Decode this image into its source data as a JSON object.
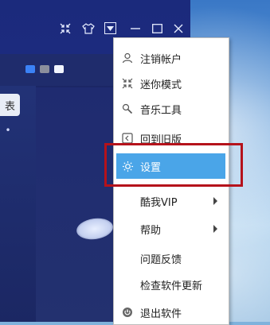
{
  "left_panel": {
    "tab_label": "表",
    "tab2_label": "•"
  },
  "menu": {
    "items": [
      {
        "label": "注销帐户",
        "icon": "user-icon"
      },
      {
        "label": "迷你模式",
        "icon": "mini-mode-icon"
      },
      {
        "label": "音乐工具",
        "icon": "tools-icon"
      },
      {
        "label": "回到旧版",
        "icon": "back-old-icon"
      },
      {
        "label": "设置",
        "icon": "gear-icon",
        "selected": true
      },
      {
        "label": "酷我VIP",
        "submenu": true
      },
      {
        "label": "帮助",
        "submenu": true
      },
      {
        "label": "问题反馈"
      },
      {
        "label": "检查软件更新"
      },
      {
        "label": "退出软件",
        "icon": "power-icon"
      }
    ]
  },
  "colors": {
    "selected": "#4aa5e8",
    "highlight_border": "#b5121b"
  }
}
